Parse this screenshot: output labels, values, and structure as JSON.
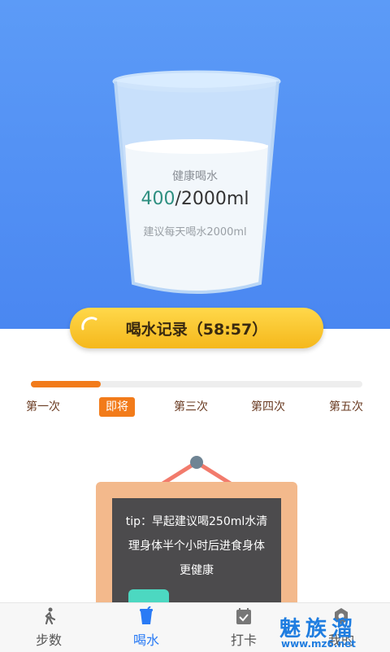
{
  "cup": {
    "title": "健康喝水",
    "current": "400",
    "target": "/2000ml",
    "tip": "建议每天喝水2000ml",
    "fill_fraction": 0.2
  },
  "record_button": {
    "label": "喝水记录（58:57）"
  },
  "progress": {
    "fraction": 0.21
  },
  "steps": [
    {
      "label": "第一次",
      "active": false
    },
    {
      "label": "即将",
      "active": true
    },
    {
      "label": "第三次",
      "active": false
    },
    {
      "label": "第四次",
      "active": false
    },
    {
      "label": "第五次",
      "active": false
    }
  ],
  "tip_board": {
    "line1": "tip：早起建议喝250ml水清",
    "line2": "理身体半个小时后进食身体",
    "line3": "更健康"
  },
  "nav": [
    {
      "label": "步数",
      "icon": "walking-icon",
      "active": false
    },
    {
      "label": "喝水",
      "icon": "cup-icon",
      "active": true
    },
    {
      "label": "打卡",
      "icon": "calendar-check-icon",
      "active": false
    },
    {
      "label": "我的",
      "icon": "settings-icon",
      "active": false
    }
  ],
  "watermark": {
    "brand": "魅族溜",
    "url": "www.mz6.net"
  },
  "colors": {
    "hero_blue": "#4a87f1",
    "accent_orange": "#f27b1a",
    "nav_active": "#2a7bf5",
    "amount_green": "#2e8f80"
  }
}
